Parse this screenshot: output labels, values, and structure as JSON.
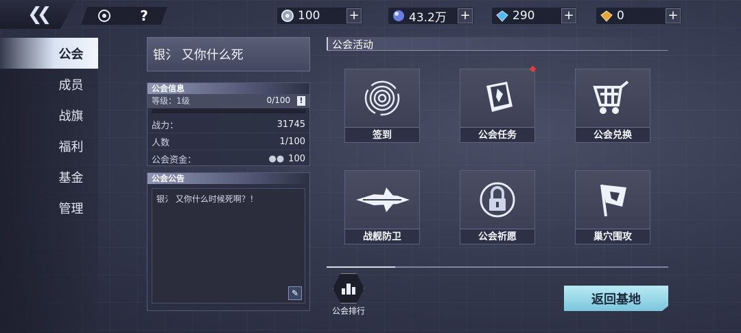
{
  "topbar": {
    "back_icon": "chevron-double-left-icon",
    "resources": [
      {
        "icon": "silver-coin-icon",
        "value": "100"
      },
      {
        "icon": "crystal-orb-icon",
        "value": "43.2万"
      },
      {
        "icon": "blue-diamond-icon",
        "value": "290"
      },
      {
        "icon": "gold-gem-icon",
        "value": "0"
      }
    ],
    "plus": "+",
    "help": "?"
  },
  "sidebar": {
    "items": [
      {
        "label": "公会",
        "active": true
      },
      {
        "label": "成员"
      },
      {
        "label": "战旗"
      },
      {
        "label": "福利"
      },
      {
        "label": "基金"
      },
      {
        "label": "管理"
      }
    ]
  },
  "guild": {
    "name": "银氵 又你什么死",
    "info_title": "公会信息",
    "level_label": "等级：1级",
    "level_progress_text": "0/100",
    "level_progress": 0,
    "bang": "!",
    "power_label": "战力：",
    "power_value": "31745",
    "members_label": "人数",
    "members_value": "1/100",
    "funds_label": "公会资金：",
    "funds_value": "100",
    "notice_title": "公会公告",
    "notice_text": "银氵 又你什么时候死啊？！"
  },
  "activities": {
    "title": "公会活动",
    "items": [
      {
        "label": "签到",
        "icon": "fingerprint-icon"
      },
      {
        "label": "公会任务",
        "icon": "quest-book-icon"
      },
      {
        "label": "公会兑换",
        "icon": "shopping-cart-icon"
      },
      {
        "label": "战舰防卫",
        "icon": "warship-icon"
      },
      {
        "label": "公会祈愿",
        "icon": "padlock-icon"
      },
      {
        "label": "巢穴围攻",
        "icon": "flag-icon"
      }
    ]
  },
  "rank_label": "公会排行",
  "return_label": "返回基地",
  "colors": {
    "accent": "#9fdcec",
    "notify": "#e03a3a"
  }
}
